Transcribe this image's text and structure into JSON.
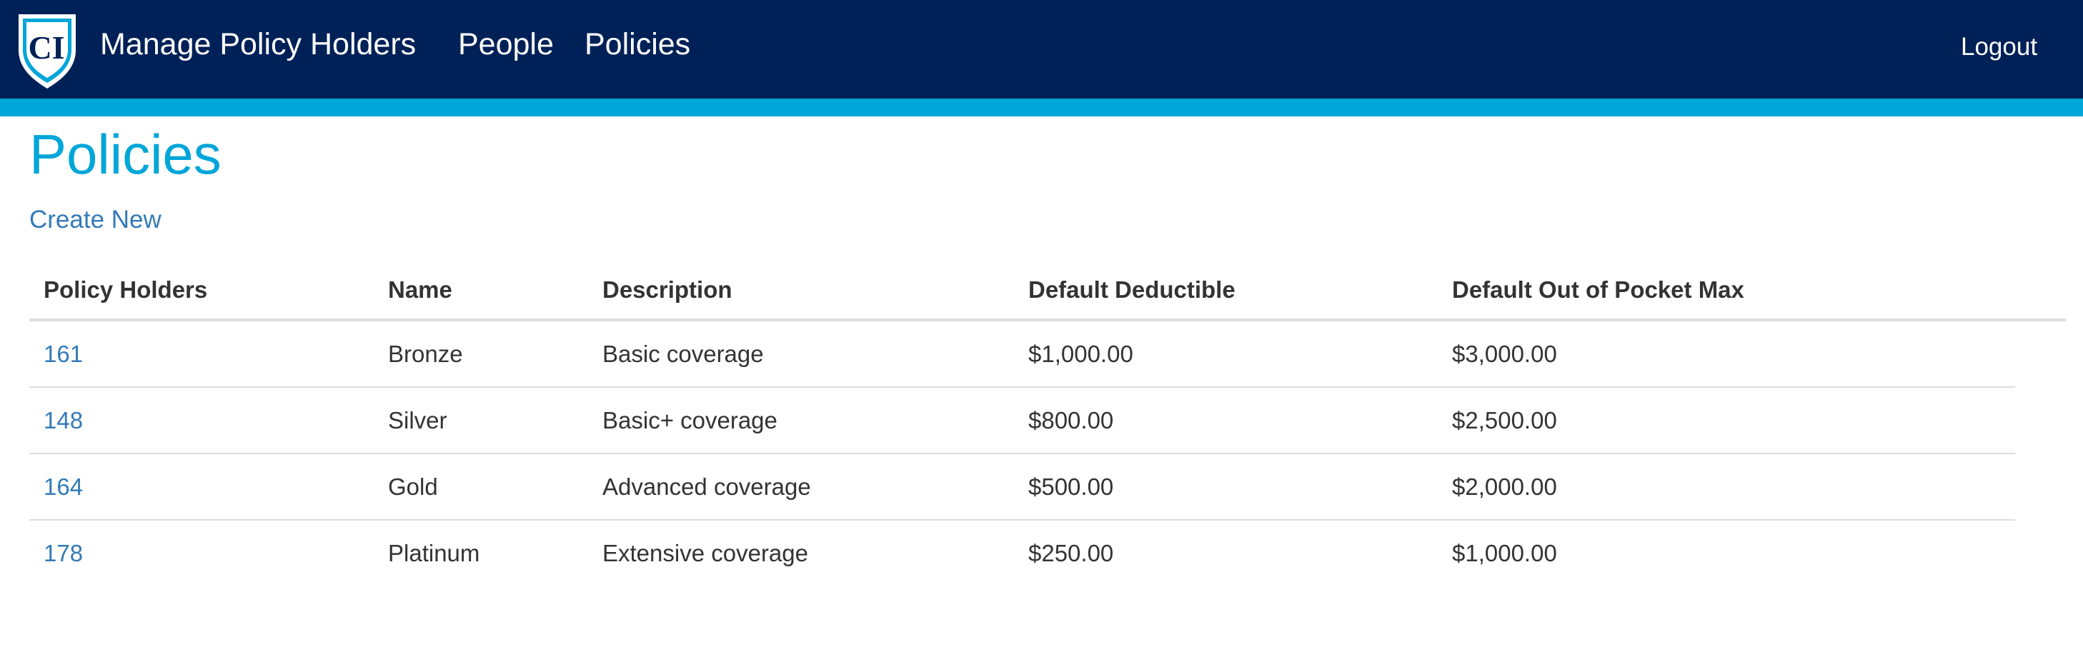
{
  "navbar": {
    "logo_text": "CI",
    "brand": "Manage Policy Holders",
    "people": "People",
    "policies": "Policies",
    "logout": "Logout",
    "colors": {
      "background": "#002157",
      "stripe": "#00a6d9"
    }
  },
  "page": {
    "title": "Policies",
    "create_new": "Create New"
  },
  "table": {
    "headers": [
      "Policy Holders",
      "Name",
      "Description",
      "Default Deductible",
      "Default Out of Pocket Max"
    ],
    "rows": [
      [
        "161",
        "Bronze",
        "Basic coverage",
        "$1,000.00",
        "$3,000.00"
      ],
      [
        "148",
        "Silver",
        "Basic+ coverage",
        "$800.00",
        "$2,500.00"
      ],
      [
        "164",
        "Gold",
        "Advanced coverage",
        "$500.00",
        "$2,000.00"
      ],
      [
        "178",
        "Platinum",
        "Extensive coverage",
        "$250.00",
        "$1,000.00"
      ]
    ]
  },
  "colors": {
    "title": "#00a6d9",
    "link": "#337ab7",
    "text": "#333333"
  }
}
